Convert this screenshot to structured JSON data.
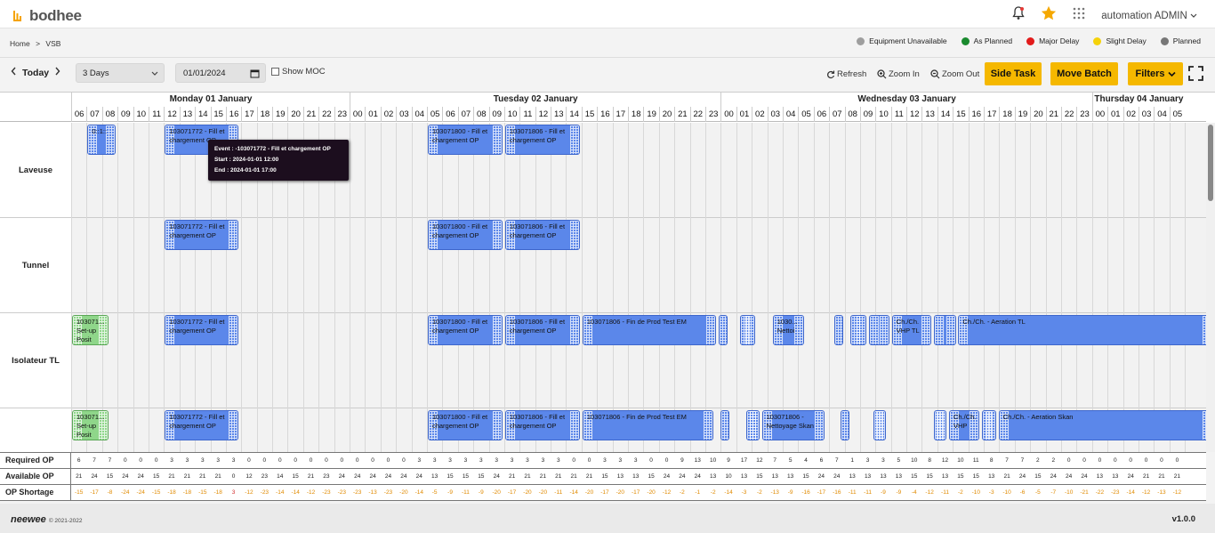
{
  "header": {
    "logo_text": "bodhee",
    "user_name": "automation ADMIN",
    "icons": [
      "bell-icon",
      "star-icon",
      "apps-grid-icon"
    ]
  },
  "breadcrumb": {
    "home": "Home",
    "separator": ">",
    "current": "VSB"
  },
  "legend": [
    {
      "label": "Equipment Unavailable",
      "color": "#9e9e9e"
    },
    {
      "label": "As Planned",
      "color": "#1a8a2e"
    },
    {
      "label": "Major Delay",
      "color": "#e21b1b"
    },
    {
      "label": "Slight Delay",
      "color": "#f5d20a"
    },
    {
      "label": "Planned",
      "color": "#777777"
    }
  ],
  "toolbar": {
    "today_label": "Today",
    "range_select": "3 Days",
    "date_value": "01/01/2024",
    "show_moc_label": "Show MOC",
    "refresh_label": "Refresh",
    "zoom_in_label": "Zoom In",
    "zoom_out_label": "Zoom Out",
    "side_task_label": "Side Task",
    "move_batch_label": "Move Batch",
    "filters_label": "Filters"
  },
  "timeline": {
    "days": [
      {
        "label": "Monday 01 January"
      },
      {
        "label": "Tuesday 02 January"
      },
      {
        "label": "Wednesday 03 January"
      },
      {
        "label": "Thursday 04 January"
      }
    ],
    "hours": [
      "06",
      "07",
      "08",
      "09",
      "10",
      "11",
      "12",
      "13",
      "14",
      "15",
      "16",
      "17",
      "18",
      "19",
      "20",
      "21",
      "22",
      "23",
      "00",
      "01",
      "02",
      "03",
      "04",
      "05",
      "06",
      "07",
      "08",
      "09",
      "10",
      "11",
      "12",
      "13",
      "14",
      "15",
      "16",
      "17",
      "18",
      "19",
      "20",
      "21",
      "22",
      "23",
      "00",
      "01",
      "02",
      "03",
      "04",
      "05",
      "06",
      "07",
      "08",
      "09",
      "10",
      "11",
      "12",
      "13",
      "14",
      "15",
      "16",
      "17",
      "18",
      "19",
      "20",
      "21",
      "22",
      "23",
      "00",
      "01",
      "02",
      "03",
      "04",
      "05"
    ]
  },
  "resources": [
    {
      "name": "Laveuse",
      "tasks": [
        {
          "text": "0::1::",
          "start": 1.0,
          "end": 2.9,
          "color": "blue"
        },
        {
          "text": "103071772 - Fill et chargement OP",
          "start": 6.0,
          "end": 10.8,
          "color": "blue"
        },
        {
          "text": "103071800 - Fill et chargement OP",
          "start": 23.0,
          "end": 27.9,
          "color": "blue"
        },
        {
          "text": "103071806 - Fill et chargement OP",
          "start": 28.0,
          "end": 32.9,
          "color": "blue"
        }
      ]
    },
    {
      "name": "Tunnel",
      "tasks": [
        {
          "text": "103071772 - Fill et chargement OP",
          "start": 6.0,
          "end": 10.8,
          "color": "blue"
        },
        {
          "text": "103071800 - Fill et chargement OP",
          "start": 23.0,
          "end": 27.9,
          "color": "blue"
        },
        {
          "text": "103071806 - Fill et chargement OP",
          "start": 28.0,
          "end": 32.9,
          "color": "blue"
        }
      ]
    },
    {
      "name": "Isolateur TL",
      "tasks": [
        {
          "text": "103071... Set-up Posit",
          "start": 0.0,
          "end": 2.4,
          "color": "green"
        },
        {
          "text": "103071772 - Fill et chargement OP",
          "start": 6.0,
          "end": 10.8,
          "color": "blue"
        },
        {
          "text": "103071800 - Fill et chargement OP",
          "start": 23.0,
          "end": 27.9,
          "color": "blue"
        },
        {
          "text": "103071806 - Fill et chargement OP",
          "start": 28.0,
          "end": 32.9,
          "color": "blue"
        },
        {
          "text": "103071806 - Fin de Prod Test EM",
          "start": 33.0,
          "end": 41.7,
          "color": "blue"
        },
        {
          "text": "",
          "start": 41.8,
          "end": 42.3,
          "color": "blue"
        },
        {
          "text": "",
          "start": 43.2,
          "end": 44.2,
          "color": "blue"
        },
        {
          "text": "1030... Nettoi",
          "start": 45.3,
          "end": 47.4,
          "color": "blue"
        },
        {
          "text": "",
          "start": 49.3,
          "end": 49.8,
          "color": "blue"
        },
        {
          "text": "",
          "start": 50.3,
          "end": 51.4,
          "color": "blue"
        },
        {
          "text": "",
          "start": 51.5,
          "end": 52.9,
          "color": "blue"
        },
        {
          "text": "Ch./Ch. VHP TL",
          "start": 53.0,
          "end": 55.6,
          "color": "blue"
        },
        {
          "text": "",
          "start": 55.7,
          "end": 57.2,
          "color": "blue"
        },
        {
          "text": "Ch./Ch. - Aeration TL",
          "start": 57.3,
          "end": 73.8,
          "color": "blue"
        }
      ]
    },
    {
      "name": "Isolateur Skan",
      "tasks": [
        {
          "text": "103071... Set-up Posit",
          "start": 0.0,
          "end": 2.4,
          "color": "green"
        },
        {
          "text": "103071772 - Fill et chargement OP",
          "start": 6.0,
          "end": 10.8,
          "color": "blue"
        },
        {
          "text": "103071800 - Fill et chargement OP",
          "start": 23.0,
          "end": 27.9,
          "color": "blue"
        },
        {
          "text": "103071806 - Fill et chargement OP",
          "start": 28.0,
          "end": 32.9,
          "color": "blue"
        },
        {
          "text": "103071806 - Fin de Prod Test EM",
          "start": 33.0,
          "end": 41.5,
          "color": "blue"
        },
        {
          "text": "",
          "start": 41.9,
          "end": 42.4,
          "color": "blue"
        },
        {
          "text": "",
          "start": 43.6,
          "end": 44.5,
          "color": "blue"
        },
        {
          "text": "103071806 - Nettoyage Skan",
          "start": 44.6,
          "end": 48.7,
          "color": "blue"
        },
        {
          "text": "",
          "start": 49.7,
          "end": 50.2,
          "color": "blue"
        },
        {
          "text": "",
          "start": 51.8,
          "end": 52.7,
          "color": "blue"
        },
        {
          "text": "",
          "start": 55.7,
          "end": 56.6,
          "color": "blue"
        },
        {
          "text": "Ch./Ch. VHP",
          "start": 56.7,
          "end": 58.7,
          "color": "blue"
        },
        {
          "text": "",
          "start": 58.8,
          "end": 59.8,
          "color": "blue"
        },
        {
          "text": "Ch./Ch. - Aeration Skan",
          "start": 59.9,
          "end": 73.8,
          "color": "blue"
        }
      ]
    }
  ],
  "tooltip": {
    "event_line": "Event : -103071772 - Fill et chargement OP",
    "start_line": "Start : 2024-01-01 12:00",
    "end_line": "End : 2024-01-01 17:00"
  },
  "stats": {
    "required_label": "Required OP",
    "available_label": "Available OP",
    "shortage_label": "OP Shortage",
    "required": [
      "6",
      "7",
      "7",
      "0",
      "0",
      "0",
      "3",
      "3",
      "3",
      "3",
      "3",
      "0",
      "0",
      "0",
      "0",
      "0",
      "0",
      "0",
      "0",
      "0",
      "0",
      "0",
      "3",
      "3",
      "3",
      "3",
      "3",
      "3",
      "3",
      "3",
      "3",
      "3",
      "0",
      "0",
      "3",
      "3",
      "3",
      "0",
      "0",
      "9",
      "13",
      "10",
      "9",
      "17",
      "12",
      "7",
      "5",
      "4",
      "6",
      "7",
      "1",
      "3",
      "3",
      "5",
      "10",
      "8",
      "12",
      "10",
      "11",
      "8",
      "7",
      "7",
      "2",
      "2",
      "0",
      "0",
      "0",
      "0",
      "0",
      "0",
      "0",
      "0"
    ],
    "available": [
      "21",
      "24",
      "15",
      "24",
      "24",
      "15",
      "21",
      "21",
      "21",
      "21",
      "0",
      "12",
      "23",
      "14",
      "15",
      "21",
      "23",
      "24",
      "24",
      "24",
      "24",
      "24",
      "24",
      "13",
      "15",
      "15",
      "15",
      "24",
      "21",
      "21",
      "21",
      "21",
      "21",
      "21",
      "15",
      "13",
      "13",
      "15",
      "24",
      "24",
      "24",
      "13",
      "10",
      "13",
      "15",
      "13",
      "13",
      "15",
      "24",
      "24",
      "13",
      "13",
      "13",
      "13",
      "15",
      "15",
      "13",
      "15",
      "15",
      "13",
      "21",
      "24",
      "15",
      "24",
      "24",
      "24",
      "13",
      "13",
      "24",
      "21",
      "21",
      "21"
    ],
    "shortage": [
      "-15",
      "-17",
      "-8",
      "-24",
      "-24",
      "-15",
      "-18",
      "-18",
      "-15",
      "-18",
      "3",
      "-12",
      "-23",
      "-14",
      "-14",
      "-12",
      "-23",
      "-23",
      "-23",
      "-13",
      "-23",
      "-20",
      "-14",
      "-5",
      "-9",
      "-11",
      "-9",
      "-20",
      "-17",
      "-20",
      "-20",
      "-11",
      "-14",
      "-20",
      "-17",
      "-20",
      "-17",
      "-20",
      "-12",
      "-2",
      "-1",
      "-2",
      "-14",
      "-3",
      "-2",
      "-13",
      "-9",
      "-16",
      "-17",
      "-16",
      "-11",
      "-11",
      "-9",
      "-9",
      "-4",
      "-12",
      "-11",
      "-2",
      "-10",
      "-3",
      "-10",
      "-6",
      "-5",
      "-7",
      "-10",
      "-21",
      "-22",
      "-23",
      "-14",
      "-12",
      "-13",
      "-12"
    ]
  },
  "footer": {
    "brand": "neewee",
    "copyright": "© 2021-2022",
    "version": "v1.0.0"
  }
}
